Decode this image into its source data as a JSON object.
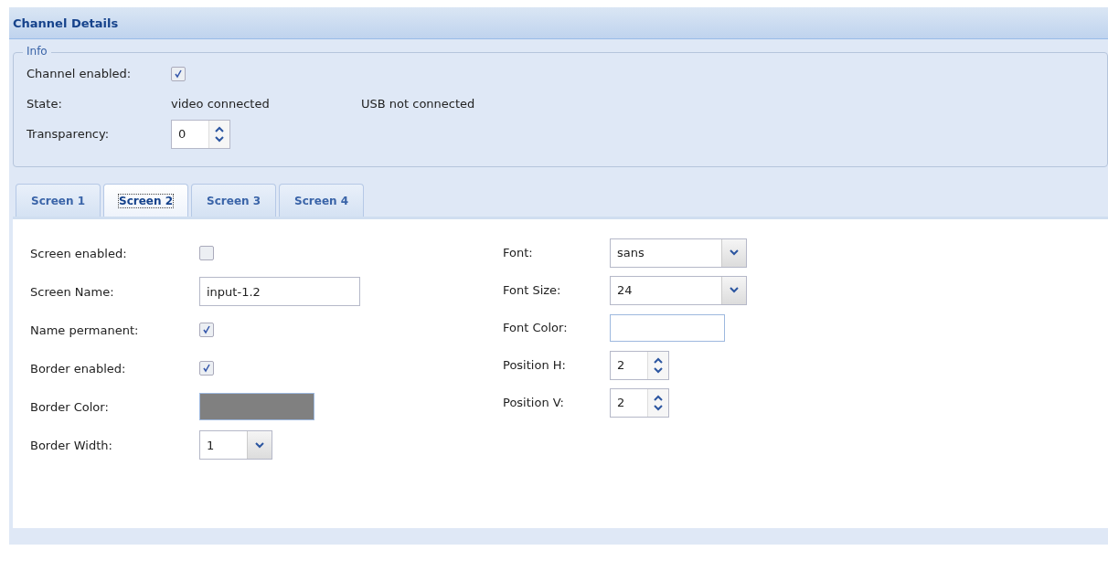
{
  "panel": {
    "title": "Channel Details"
  },
  "info": {
    "legend": "Info",
    "channel_enabled": {
      "label": "Channel enabled:",
      "checked": true
    },
    "state": {
      "label": "State:",
      "video": "video connected",
      "usb": "USB not connected"
    },
    "transparency": {
      "label": "Transparency:",
      "value": "0"
    }
  },
  "tabs": [
    {
      "label": "Screen 1",
      "selected": false
    },
    {
      "label": "Screen 2",
      "selected": true
    },
    {
      "label": "Screen 3",
      "selected": false
    },
    {
      "label": "Screen 4",
      "selected": false
    }
  ],
  "left_fields": [
    {
      "kind": "checkbox",
      "label": "Screen enabled:",
      "checked": false
    },
    {
      "kind": "text",
      "label": "Screen Name:",
      "value": "input-1.2"
    },
    {
      "kind": "checkbox",
      "label": "Name permanent:",
      "checked": true
    },
    {
      "kind": "checkbox",
      "label": "Border enabled:",
      "checked": true
    },
    {
      "kind": "color",
      "label": "Border Color:",
      "color": "#808080"
    },
    {
      "kind": "select",
      "label": "Border Width:",
      "value": "1"
    }
  ],
  "right_fields": [
    {
      "kind": "select",
      "label": "Font:",
      "value": "sans"
    },
    {
      "kind": "select",
      "label": "Font Size:",
      "value": "24"
    },
    {
      "kind": "color",
      "label": "Font Color:",
      "color": "#ffffff"
    },
    {
      "kind": "spinner",
      "label": "Position H:",
      "value": "2"
    },
    {
      "kind": "spinner",
      "label": "Position V:",
      "value": "2"
    }
  ]
}
